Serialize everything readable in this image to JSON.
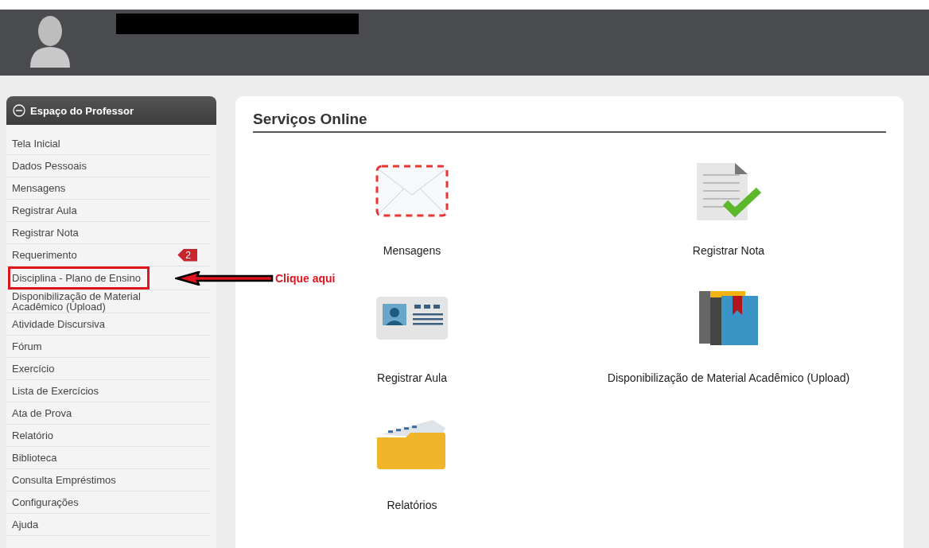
{
  "sidebar": {
    "title": "Espaço do Professor",
    "items": [
      {
        "label": "Tela Inicial",
        "highlighted": false
      },
      {
        "label": "Dados Pessoais",
        "highlighted": false
      },
      {
        "label": "Mensagens",
        "highlighted": false
      },
      {
        "label": "Registrar Aula",
        "highlighted": false
      },
      {
        "label": "Registrar Nota",
        "highlighted": false
      },
      {
        "label": "Requerimento",
        "badge": "2",
        "highlighted": false
      },
      {
        "label": "Disciplina - Plano de Ensino",
        "highlighted": true
      },
      {
        "label": "Disponibilização de Material Acadêmico (Upload)",
        "highlighted": false
      },
      {
        "label": "Atividade Discursiva",
        "highlighted": false
      },
      {
        "label": "Fórum",
        "highlighted": false
      },
      {
        "label": "Exercício",
        "highlighted": false
      },
      {
        "label": "Lista de Exercícios",
        "highlighted": false
      },
      {
        "label": "Ata de Prova",
        "highlighted": false
      },
      {
        "label": "Relatório",
        "highlighted": false
      },
      {
        "label": "Biblioteca",
        "highlighted": false
      },
      {
        "label": "Consulta Empréstimos",
        "highlighted": false
      },
      {
        "label": "Configurações",
        "highlighted": false
      },
      {
        "label": "Ajuda",
        "highlighted": false
      }
    ]
  },
  "annotation": {
    "label": "Clique aqui"
  },
  "panel": {
    "title": "Serviços Online",
    "services": [
      {
        "label": "Mensagens",
        "kind": "envelope"
      },
      {
        "label": "Registrar Nota",
        "kind": "document"
      },
      {
        "label": "Registrar Aula",
        "kind": "card"
      },
      {
        "label": "Disponibilização de Material Acadêmico (Upload)",
        "kind": "books"
      },
      {
        "label": "Relatórios",
        "kind": "folder"
      }
    ]
  }
}
